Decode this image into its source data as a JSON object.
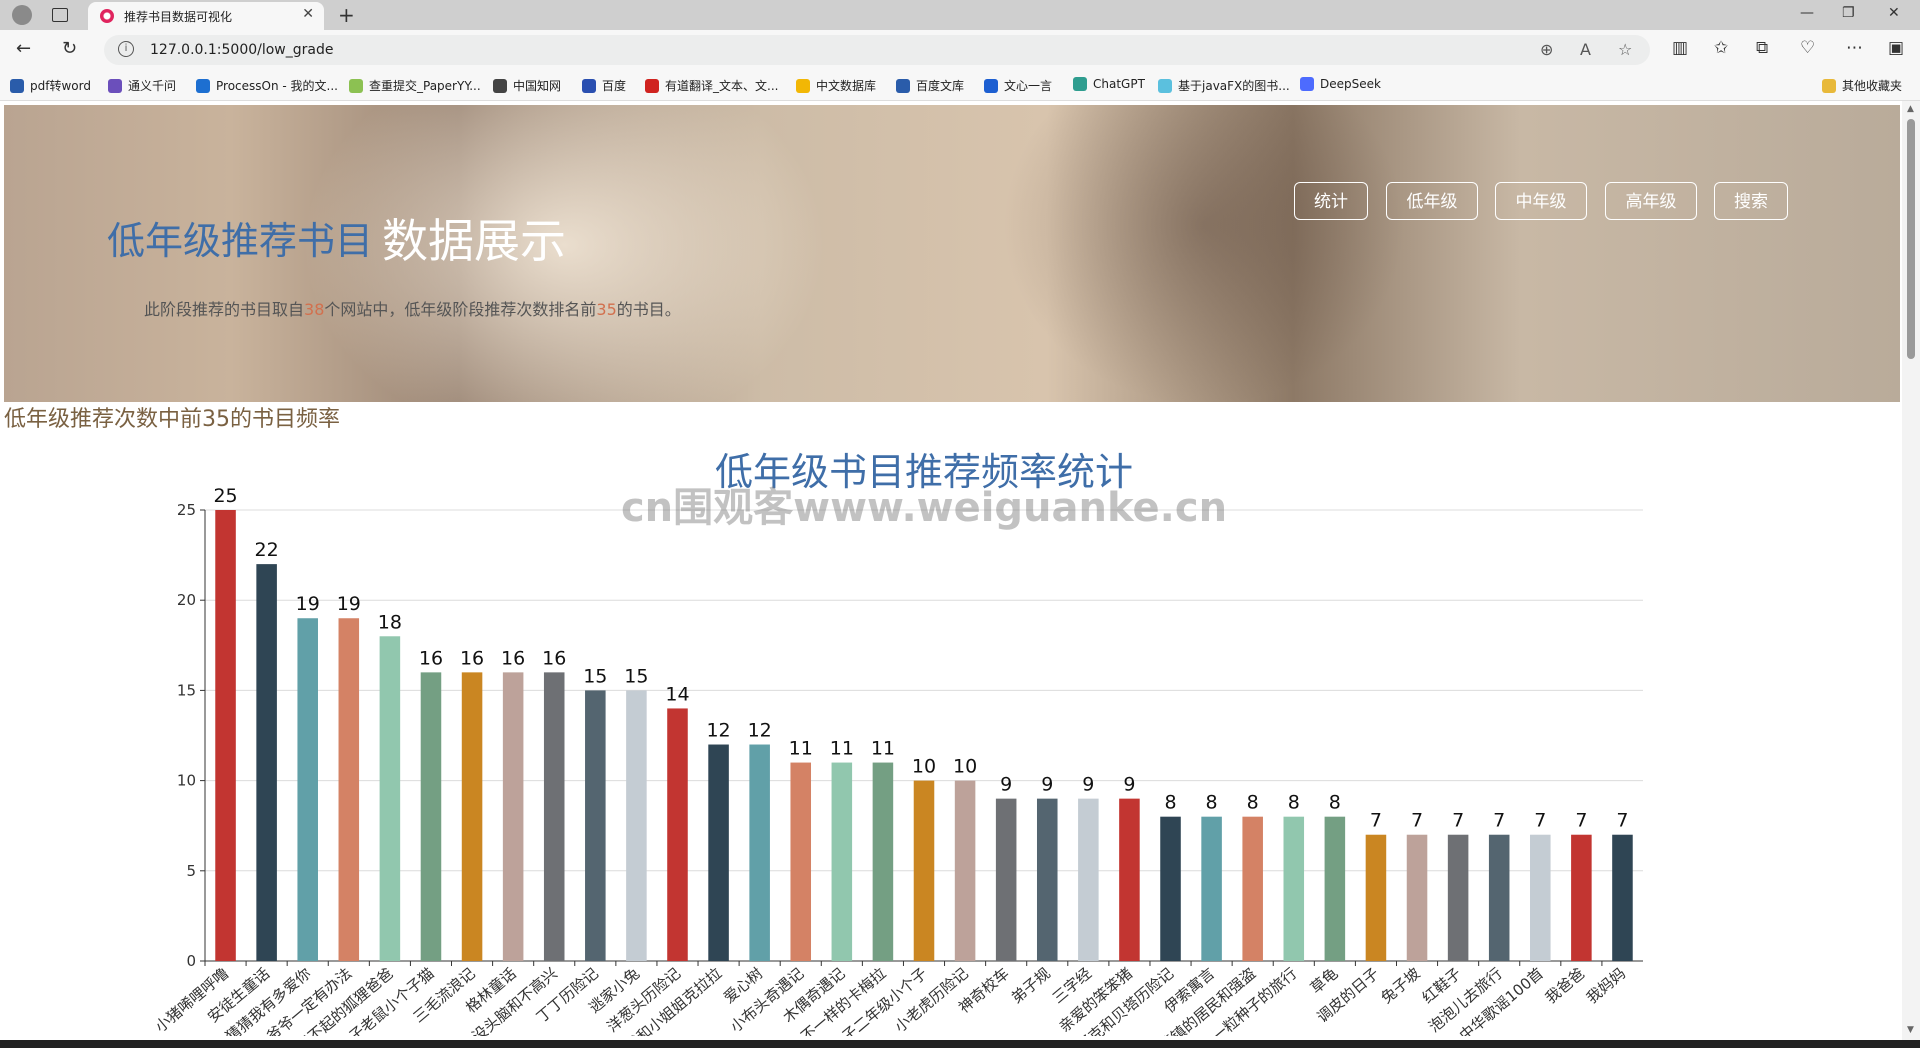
{
  "browser": {
    "tab_title": "推荐书目数据可视化",
    "url": "127.0.0.1:5000/low_grade",
    "bookmarks": [
      "pdf转word",
      "通义千问",
      "ProcessOn - 我的文...",
      "查重提交_PaperYY...",
      "中国知网",
      "百度",
      "有道翻译_文本、文...",
      "中文数据库",
      "百度文库",
      "文心一言",
      "ChatGPT",
      "基于javaFX的图书...",
      "DeepSeek"
    ],
    "bookmark_colors": [
      "#2a5caa",
      "#6b4fbb",
      "#1d6fd1",
      "#8cc152",
      "#444",
      "#2a4fb0",
      "#d0231f",
      "#f2b705",
      "#2a5caa",
      "#1d5fd1",
      "#2f9d8f",
      "#5bc0de",
      "#4d6bfe"
    ],
    "other_bookmarks": "其他收藏夹"
  },
  "hero": {
    "title_main": "低年级推荐书目",
    "title_accent": "数据展示",
    "desc_prefix": "此阶段推荐的书目取自",
    "desc_num1": "38",
    "desc_mid": "个网站中，低年级阶段推荐次数排名前",
    "desc_num2": "35",
    "desc_suffix": "的书目。",
    "nav": [
      "统计",
      "低年级",
      "中年级",
      "高年级",
      "搜索"
    ]
  },
  "section_title": "低年级推荐次数中前35的书目频率",
  "watermark": "cn围观客www.weiguanke.cn",
  "chart_data": {
    "type": "bar",
    "title": "低年级书目推荐频率统计",
    "ylim": [
      0,
      25
    ],
    "yticks": [
      0,
      5,
      10,
      15,
      20,
      25
    ],
    "grid": true,
    "categories": [
      "小猪唏哩呼噜",
      "安徒生童话",
      "猜猜我有多爱你",
      "爷爷一定有办法",
      "了不起的狐狸爸爸",
      "大个子老鼠小个子猫",
      "三毛流浪记",
      "格林童话",
      "没头脑和不高兴",
      "丁丁历险记",
      "逃家小兔",
      "洋葱头历险记",
      "我和小姐姐克拉拉",
      "爱心树",
      "小布头奇遇记",
      "木偶奇遇记",
      "不一样的卡梅拉",
      "一年级大个子二年级小个子",
      "小老虎历险记",
      "神奇校车",
      "弟子规",
      "三字经",
      "亲爱的笨笨猪",
      "舒克和贝塔历险记",
      "伊索寓言",
      "豆蔻镇的居民和强盗",
      "一粒种子的旅行",
      "草龟",
      "调皮的日子",
      "兔子坡",
      "红鞋子",
      "泡泡儿去旅行",
      "中华歌谣100首",
      "我爸爸",
      "我妈妈"
    ],
    "values": [
      25,
      22,
      19,
      19,
      18,
      16,
      16,
      16,
      16,
      15,
      15,
      14,
      12,
      12,
      11,
      11,
      11,
      10,
      10,
      9,
      9,
      9,
      9,
      8,
      8,
      8,
      8,
      8,
      7,
      7,
      7,
      7,
      7,
      7,
      7
    ],
    "palette": [
      "#c23531",
      "#2f4554",
      "#61a0a8",
      "#d48265",
      "#91c7ae",
      "#749f83",
      "#ca8622",
      "#bda29a",
      "#6e7074",
      "#546570",
      "#c4ccd3"
    ]
  }
}
